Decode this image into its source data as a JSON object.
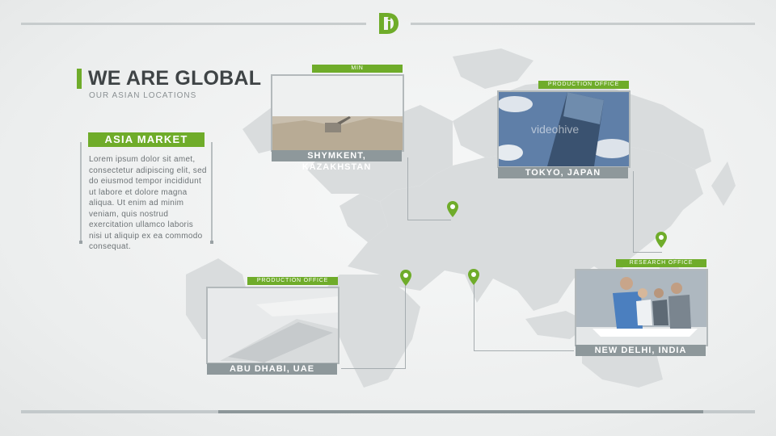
{
  "brand": {
    "accent": "#6fac2a",
    "logo_letters": "Di"
  },
  "header": {
    "title": "WE ARE GLOBAL",
    "subtitle": "OUR ASIAN LOCATIONS"
  },
  "market": {
    "label": "ASIA MARKET",
    "body": "Lorem ipsum dolor sit amet, consectetur adipiscing elit, sed do eiusmod tempor incididunt ut labore et dolore magna aliqua. Ut enim ad minim veniam, quis nostrud exercitation ullamco laboris nisi ut aliquip ex ea commodo consequat."
  },
  "locations": [
    {
      "tag": "MIN",
      "caption": "SHYMKENT, KAZAKHSTAN",
      "image": "industrial-site-photo"
    },
    {
      "tag": "PRODUCTION OFFICE",
      "caption": "TOKYO, JAPAN",
      "image": "office-tower-photo",
      "watermark": "videohive"
    },
    {
      "tag": "PRODUCTION OFFICE",
      "caption": "ABU DHABI, UAE",
      "image": "keyboard-photo"
    },
    {
      "tag": "RESEARCH OFFICE",
      "caption": "NEW DELHI, INDIA",
      "image": "team-meeting-photo"
    }
  ],
  "icons": [
    "map-pin-icon",
    "world-map"
  ]
}
